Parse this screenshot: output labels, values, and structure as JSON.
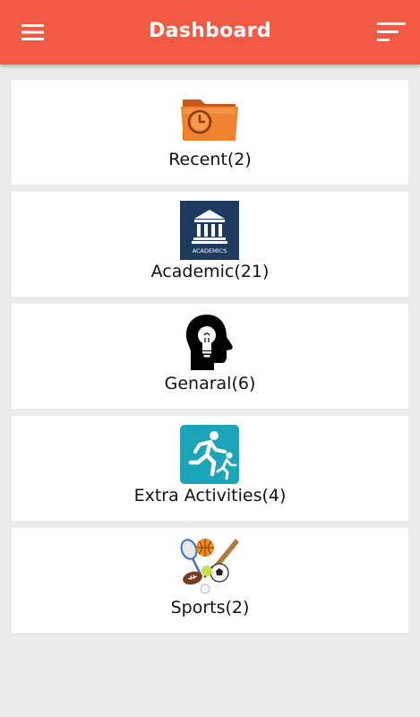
{
  "header": {
    "title": "Dashboard",
    "color": "#f25a43",
    "menu_icon": "hamburger-menu-icon",
    "sort_icon": "sort-lines-icon"
  },
  "cards": [
    {
      "label": "Recent(2)",
      "icon": "folder-clock-icon"
    },
    {
      "label": "Academic(21)",
      "icon": "academics-building-icon"
    },
    {
      "label": "Genaral(6)",
      "icon": "head-lightbulb-icon"
    },
    {
      "label": "Extra Activities(4)",
      "icon": "running-figures-icon"
    },
    {
      "label": "Sports(2)",
      "icon": "sports-balls-icon"
    }
  ],
  "icon_texts": {
    "academics": "ACADEMICS"
  }
}
